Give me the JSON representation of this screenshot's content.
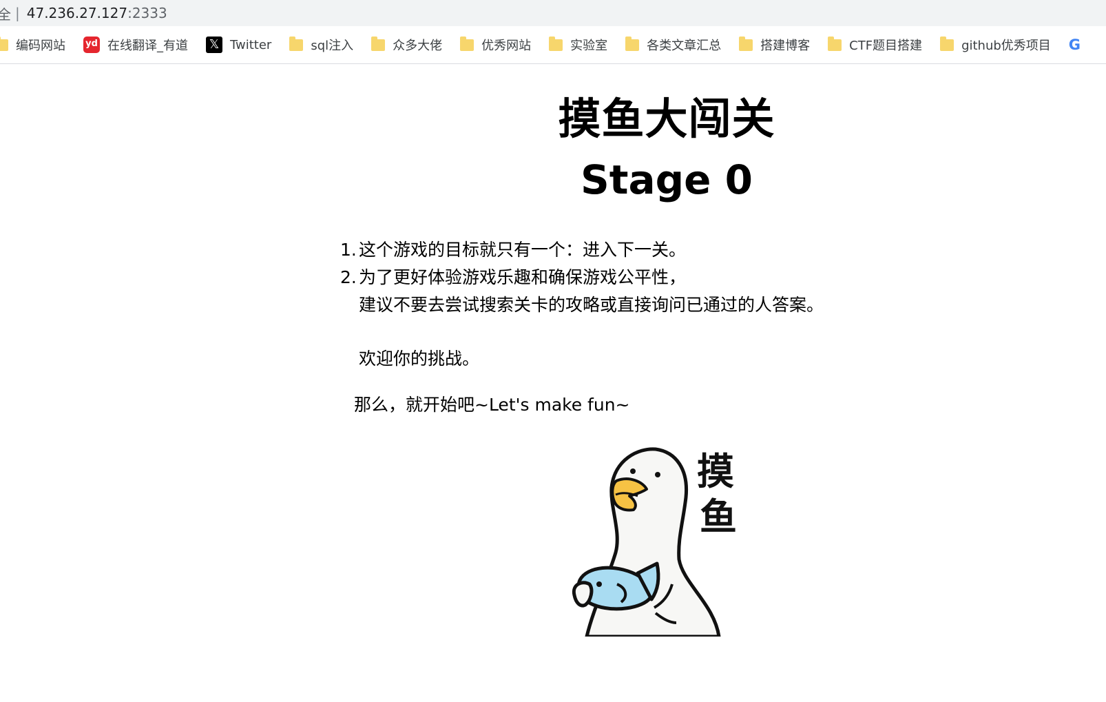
{
  "address_bar": {
    "security_label": "全",
    "separator": "|",
    "url_host": "47.236.27.127",
    "url_port": ":2333"
  },
  "bookmarks": [
    {
      "label": "编码网站",
      "icon": "folder-icon"
    },
    {
      "label": "在线翻译_有道",
      "icon": "youdao-icon"
    },
    {
      "label": "Twitter",
      "icon": "x-logo-icon"
    },
    {
      "label": "sql注入",
      "icon": "folder-icon"
    },
    {
      "label": "众多大佬",
      "icon": "folder-icon"
    },
    {
      "label": "优秀网站",
      "icon": "folder-icon"
    },
    {
      "label": "实验室",
      "icon": "folder-icon"
    },
    {
      "label": "各类文章汇总",
      "icon": "folder-icon"
    },
    {
      "label": "搭建博客",
      "icon": "folder-icon"
    },
    {
      "label": "CTF题目搭建",
      "icon": "folder-icon"
    },
    {
      "label": "github优秀项目",
      "icon": "folder-icon"
    },
    {
      "label": "",
      "icon": "google-icon"
    }
  ],
  "page": {
    "title": "摸鱼大闯关",
    "stage": "Stage 0",
    "rules": [
      {
        "number": "1.",
        "text": "这个游戏的目标就只有一个：进入下一关。"
      },
      {
        "number": "2.",
        "text": "为了更好体验游戏乐趣和确保游戏公平性，",
        "continuation": "建议不要去尝试搜索关卡的攻略或直接询问已通过的人答案。"
      }
    ],
    "welcome": "欢迎你的挑战。",
    "lets_go": "那么，就开始吧~Let's make fun~",
    "illustration": {
      "caption": "摸鱼",
      "description_icon": "duck-holding-fish"
    }
  },
  "colors": {
    "address_bar_bg": "#f1f3f4",
    "folder": "#f7d66c",
    "youdao": "#e5262e",
    "duck_beak": "#f6c244",
    "fish": "#a9dcf2"
  }
}
